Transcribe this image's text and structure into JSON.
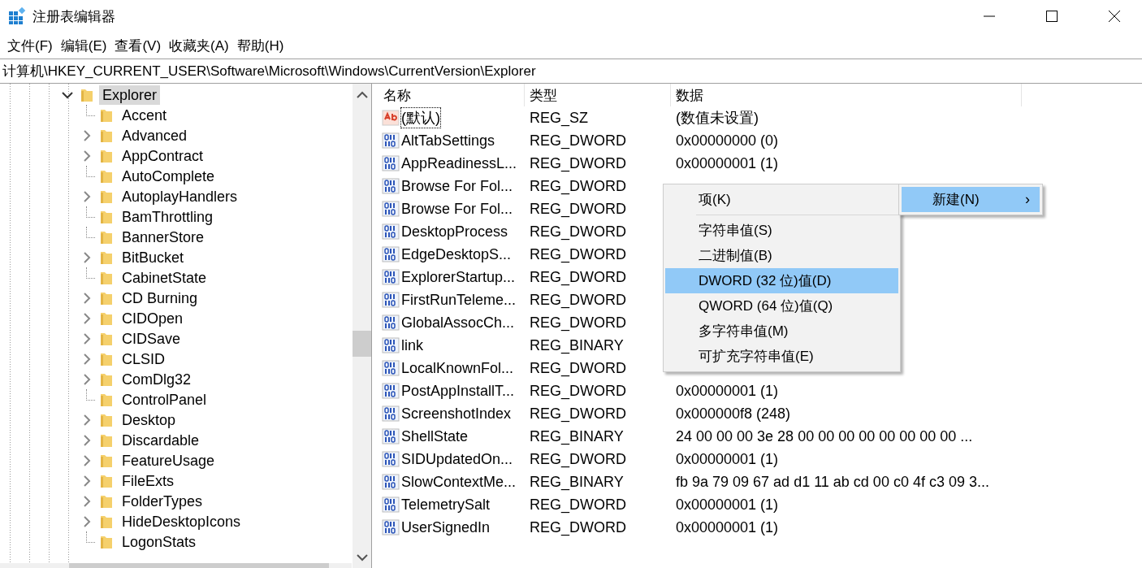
{
  "window": {
    "title": "注册表编辑器"
  },
  "menu_bar": [
    "文件(F)",
    "编辑(E)",
    "查看(V)",
    "收藏夹(A)",
    "帮助(H)"
  ],
  "address": "计算机\\HKEY_CURRENT_USER\\Software\\Microsoft\\Windows\\CurrentVersion\\Explorer",
  "tree": {
    "items": [
      {
        "label": "Explorer",
        "expanded": true,
        "selected": true,
        "children": [
          {
            "label": "Accent",
            "expandable": false,
            "selected": false
          },
          {
            "label": "Advanced",
            "expandable": true,
            "selected": false
          },
          {
            "label": "AppContract",
            "expandable": true,
            "selected": false
          },
          {
            "label": "AutoComplete",
            "expandable": false,
            "selected": false
          },
          {
            "label": "AutoplayHandlers",
            "expandable": true,
            "selected": false
          },
          {
            "label": "BamThrottling",
            "expandable": false,
            "selected": false
          },
          {
            "label": "BannerStore",
            "expandable": false,
            "selected": false
          },
          {
            "label": "BitBucket",
            "expandable": true,
            "selected": false
          },
          {
            "label": "CabinetState",
            "expandable": false,
            "selected": false
          },
          {
            "label": "CD Burning",
            "expandable": true,
            "selected": false
          },
          {
            "label": "CIDOpen",
            "expandable": true,
            "selected": false
          },
          {
            "label": "CIDSave",
            "expandable": true,
            "selected": false
          },
          {
            "label": "CLSID",
            "expandable": true,
            "selected": false
          },
          {
            "label": "ComDlg32",
            "expandable": true,
            "selected": false
          },
          {
            "label": "ControlPanel",
            "expandable": false,
            "selected": false
          },
          {
            "label": "Desktop",
            "expandable": true,
            "selected": false
          },
          {
            "label": "Discardable",
            "expandable": true,
            "selected": false
          },
          {
            "label": "FeatureUsage",
            "expandable": true,
            "selected": false
          },
          {
            "label": "FileExts",
            "expandable": true,
            "selected": false
          },
          {
            "label": "FolderTypes",
            "expandable": true,
            "selected": false
          },
          {
            "label": "HideDesktopIcons",
            "expandable": true,
            "selected": false
          },
          {
            "label": "LogonStats",
            "expandable": false,
            "selected": false
          }
        ]
      }
    ]
  },
  "table": {
    "columns": [
      "名称",
      "类型",
      "数据"
    ],
    "rows": [
      {
        "kind": "string",
        "name": "(默认)",
        "type": "REG_SZ",
        "data": "(数值未设置)",
        "focused": true
      },
      {
        "kind": "binary",
        "name": "AltTabSettings",
        "type": "REG_DWORD",
        "data": "0x00000000 (0)",
        "focused": false
      },
      {
        "kind": "binary",
        "name": "AppReadinessL...",
        "type": "REG_DWORD",
        "data": "0x00000001 (1)",
        "focused": false
      },
      {
        "kind": "binary",
        "name": "Browse For Fol...",
        "type": "REG_DWORD",
        "focused": false
      },
      {
        "kind": "binary",
        "name": "Browse For Fol...",
        "type": "REG_DWORD",
        "focused": false
      },
      {
        "kind": "binary",
        "name": "DesktopProcess",
        "type": "REG_DWORD",
        "focused": false
      },
      {
        "kind": "binary",
        "name": "EdgeDesktopS...",
        "type": "REG_DWORD",
        "focused": false
      },
      {
        "kind": "binary",
        "name": "ExplorerStartup...",
        "type": "REG_DWORD",
        "focused": false
      },
      {
        "kind": "binary",
        "name": "FirstRunTeleme...",
        "type": "REG_DWORD",
        "focused": false
      },
      {
        "kind": "binary",
        "name": "GlobalAssocCh...",
        "type": "REG_DWORD",
        "focused": false
      },
      {
        "kind": "binary",
        "name": "link",
        "type": "REG_BINARY",
        "focused": false
      },
      {
        "kind": "binary",
        "name": "LocalKnownFol...",
        "type": "REG_DWORD",
        "focused": false
      },
      {
        "kind": "binary",
        "name": "PostAppInstallT...",
        "type": "REG_DWORD",
        "data": "0x00000001 (1)",
        "focused": false
      },
      {
        "kind": "binary",
        "name": "ScreenshotIndex",
        "type": "REG_DWORD",
        "data": "0x000000f8 (248)",
        "focused": false
      },
      {
        "kind": "binary",
        "name": "ShellState",
        "type": "REG_BINARY",
        "data": "24 00 00 00 3e 28 00 00 00 00 00 00 00 00 ...",
        "focused": false
      },
      {
        "kind": "binary",
        "name": "SIDUpdatedOn...",
        "type": "REG_DWORD",
        "data": "0x00000001 (1)",
        "focused": false
      },
      {
        "kind": "binary",
        "name": "SlowContextMe...",
        "type": "REG_BINARY",
        "data": "fb 9a 79 09 67 ad d1 11 ab cd 00 c0 4f c3 09 3...",
        "focused": false
      },
      {
        "kind": "binary",
        "name": "TelemetrySalt",
        "type": "REG_DWORD",
        "data": "0x00000001 (1)",
        "focused": false
      },
      {
        "kind": "binary",
        "name": "UserSignedIn",
        "type": "REG_DWORD",
        "data": "0x00000001 (1)",
        "focused": false
      }
    ]
  },
  "context_menu": {
    "items": [
      {
        "kind": "item",
        "label": "项(K)",
        "selected": false
      },
      {
        "kind": "separator"
      },
      {
        "kind": "item",
        "label": "字符串值(S)",
        "selected": false
      },
      {
        "kind": "item",
        "label": "二进制值(B)",
        "selected": false
      },
      {
        "kind": "item",
        "label": "DWORD (32 位)值(D)",
        "selected": true
      },
      {
        "kind": "item",
        "label": "QWORD (64 位)值(Q)",
        "selected": false
      },
      {
        "kind": "item",
        "label": "多字符串值(M)",
        "selected": false
      },
      {
        "kind": "item",
        "label": "可扩充字符串值(E)",
        "selected": false
      }
    ]
  },
  "parent_menu": {
    "label": "新建(N)",
    "arrow": "›",
    "selected": true
  }
}
